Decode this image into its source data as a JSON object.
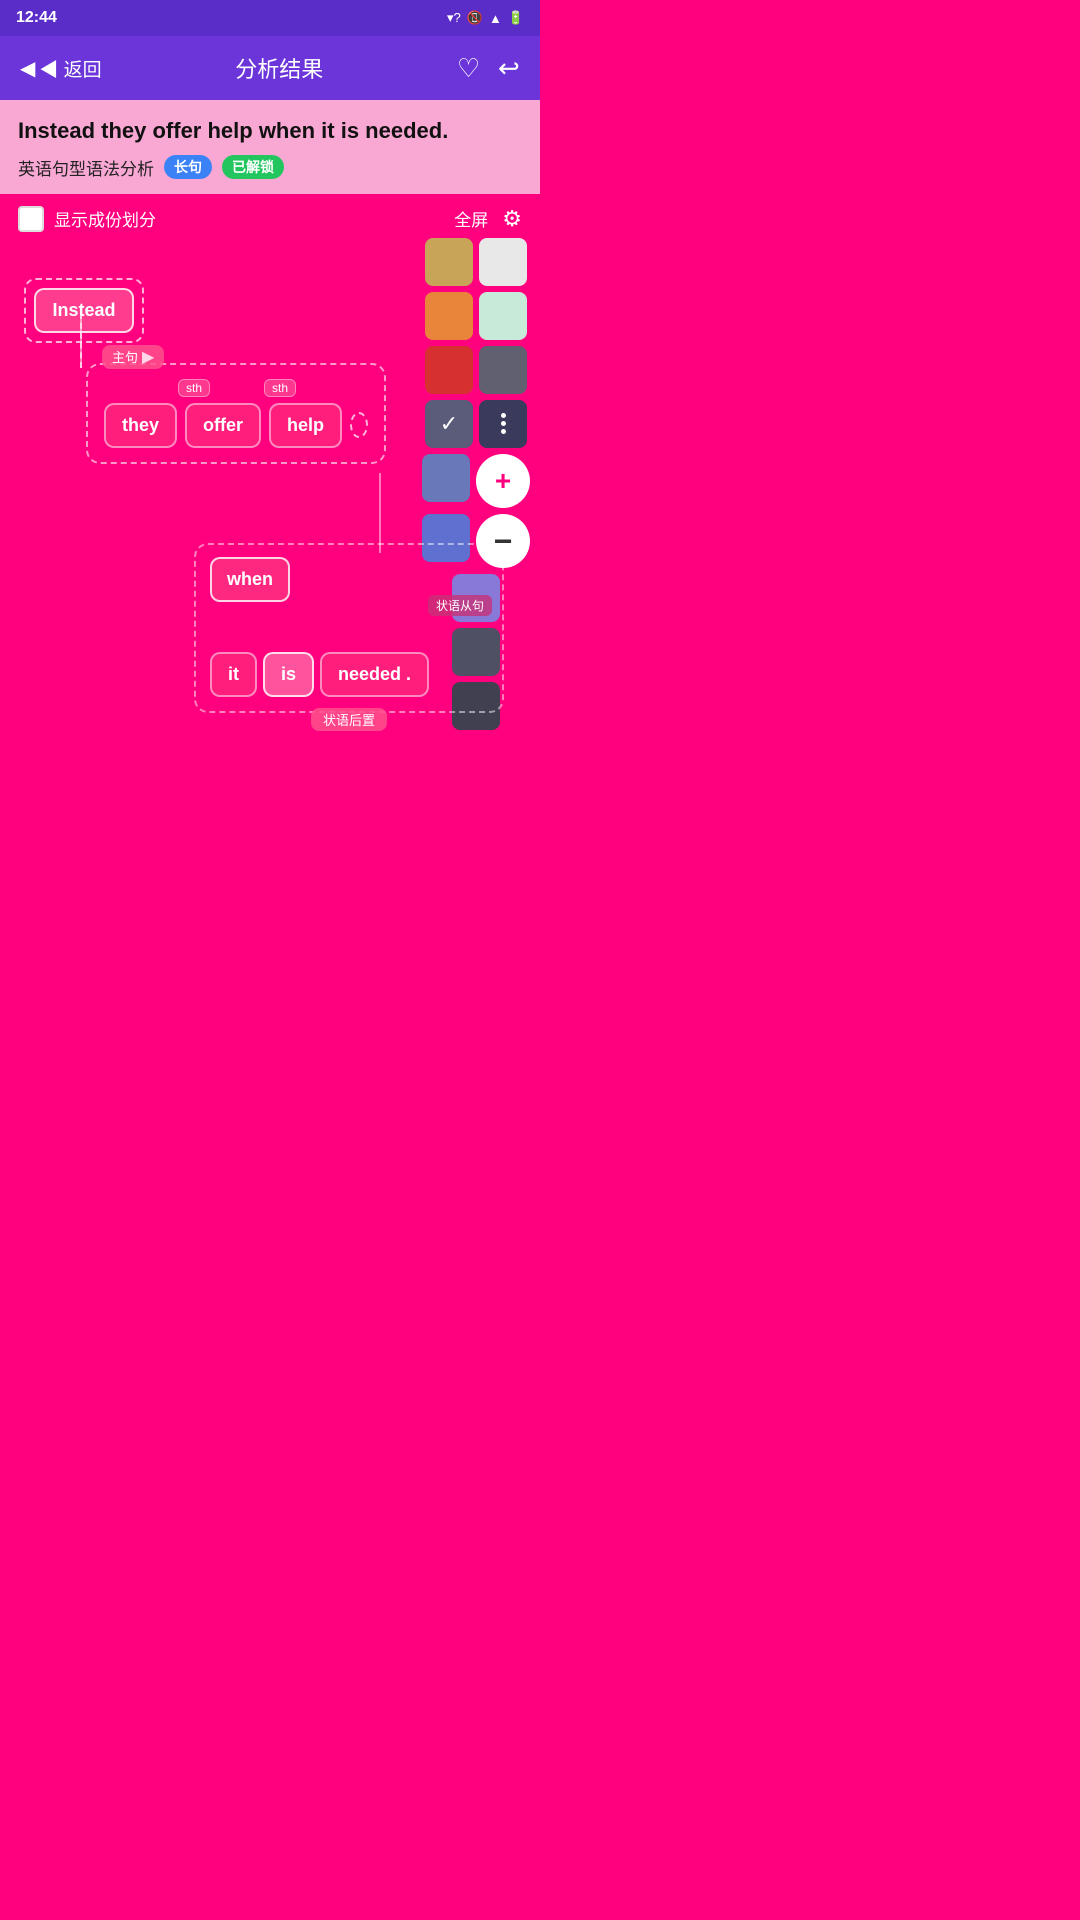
{
  "statusBar": {
    "time": "12:44",
    "icons": [
      "wifi",
      "data",
      "battery"
    ]
  },
  "header": {
    "back_label": "◀ 返回",
    "title": "分析结果",
    "heart_icon": "♡",
    "share_icon": "↪"
  },
  "sentenceBanner": {
    "sentence": "Instead they offer help when it is needed.",
    "meta_label": "英语句型语法分析",
    "badge1": "长句",
    "badge2": "已解锁"
  },
  "toolbar": {
    "checkbox_label": "显示成份划分",
    "fullscreen_label": "全屏",
    "gear_icon": "⚙"
  },
  "colorPalette": {
    "swatches": [
      {
        "color": "#C8A458",
        "label": "gold"
      },
      {
        "color": "#E8E8E8",
        "label": "light-gray"
      },
      {
        "color": "#E8853A",
        "label": "orange"
      },
      {
        "color": "#C8EAD8",
        "label": "mint"
      },
      {
        "color": "#D63030",
        "label": "red"
      },
      {
        "color": "#606070",
        "label": "dark-gray"
      },
      {
        "color": "#6878B8",
        "label": "slate-blue"
      },
      {
        "color": "#6070D0",
        "label": "blue"
      },
      {
        "color": "#8878D8",
        "label": "purple"
      },
      {
        "color": "#505065",
        "label": "dark-slate"
      },
      {
        "color": "#404050",
        "label": "darkest-slate"
      }
    ]
  },
  "diagram": {
    "instead_word": "Instead",
    "main_clause_label": "主句",
    "sth_tag1": "sth",
    "sth_tag2": "sth",
    "word_they": "they",
    "word_offer": "offer",
    "word_help": "help",
    "when_word": "when",
    "adv_clause_label": "状语从句",
    "word_it": "it",
    "word_is": "is",
    "word_needed": "needed .",
    "position_label": "状语后置"
  }
}
